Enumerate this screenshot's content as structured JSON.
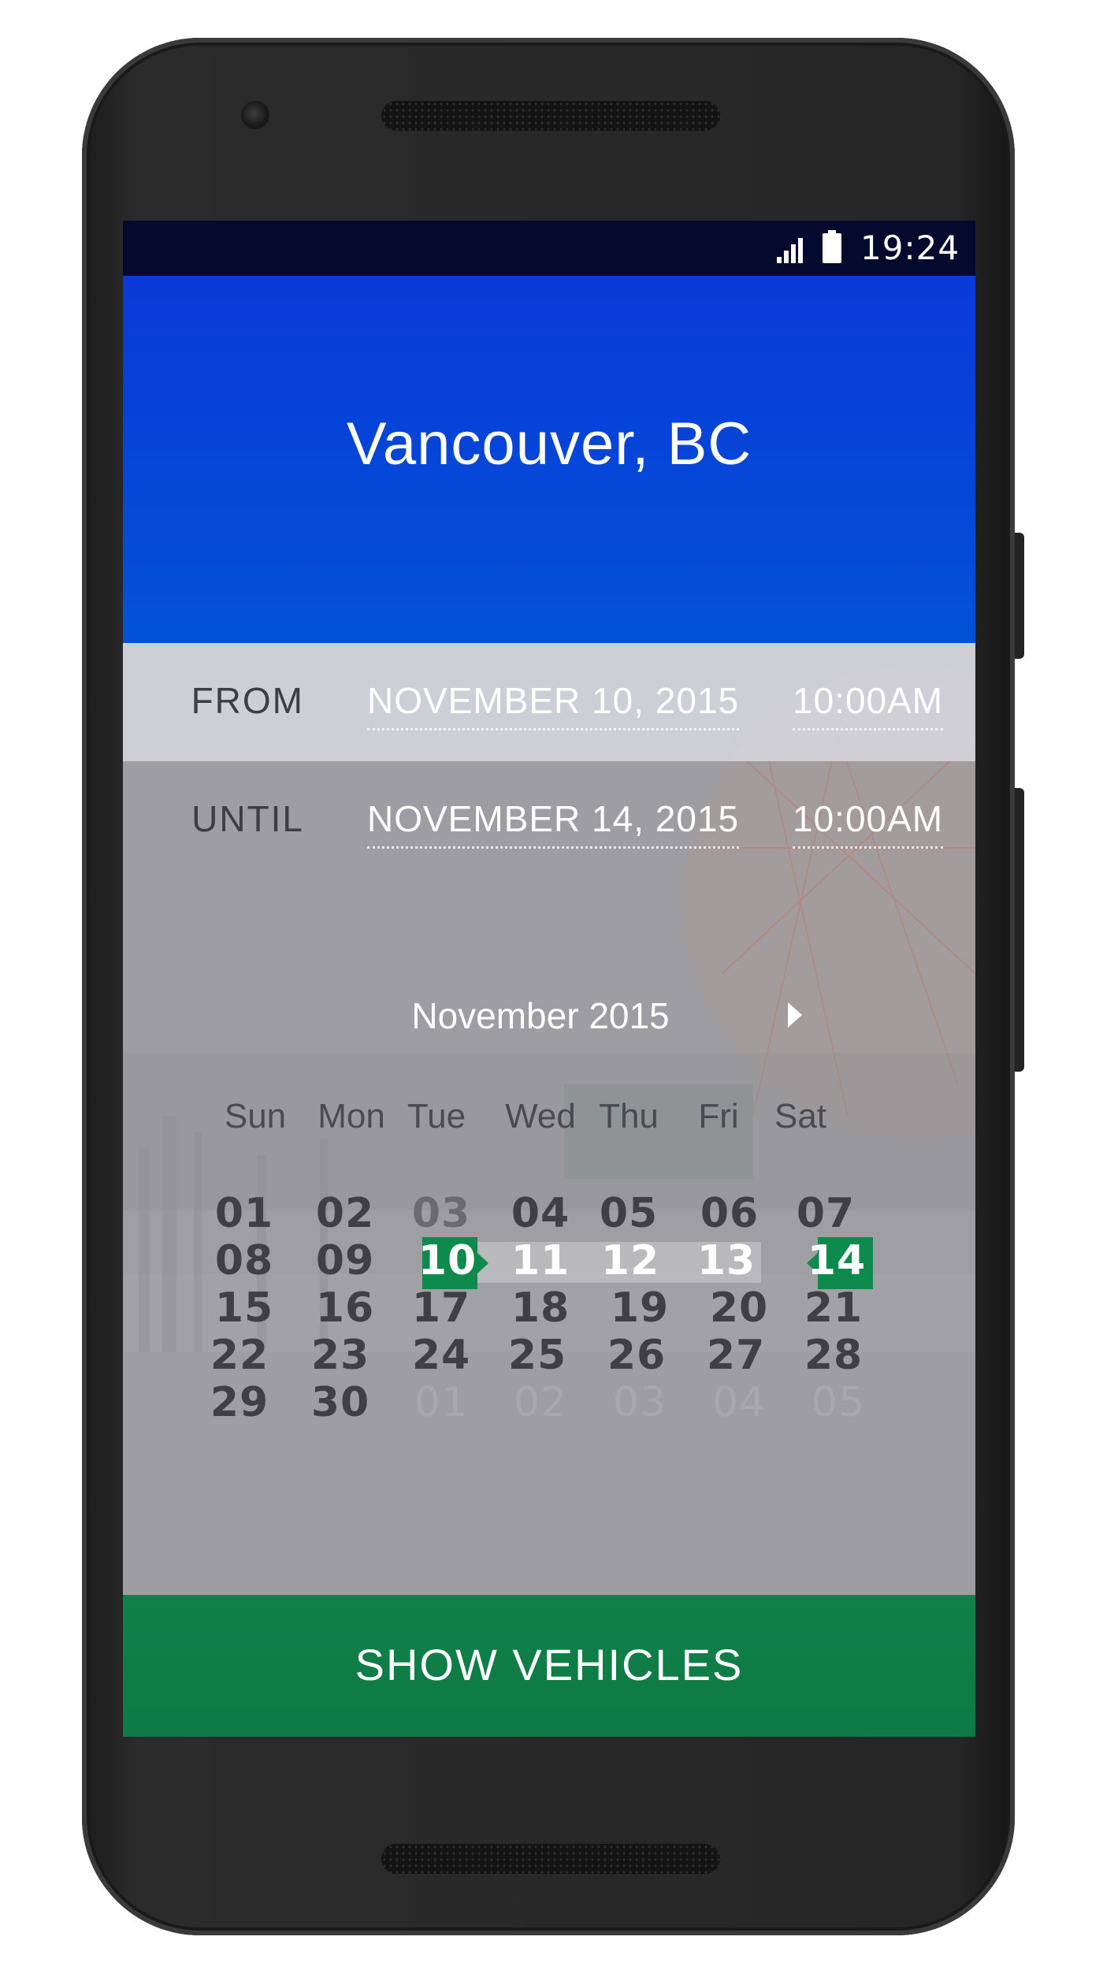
{
  "status_bar": {
    "time": "19:24",
    "icons": [
      "signal-icon",
      "battery-icon"
    ]
  },
  "header": {
    "city": "Vancouver, BC"
  },
  "rental": {
    "from": {
      "label": "FROM",
      "date": "NOVEMBER 10, 2015",
      "time": "10:00AM"
    },
    "until": {
      "label": "UNTIL",
      "date": "NOVEMBER 14, 2015",
      "time": "10:00AM"
    }
  },
  "calendar": {
    "month_title": "November 2015",
    "next_icon": "chevron-right-icon",
    "weekdays": [
      "Sun",
      "Mon",
      "Tue",
      "Wed",
      "Thu",
      "Fri",
      "Sat"
    ],
    "weeks": [
      [
        "01",
        "02",
        "03",
        "04",
        "05",
        "06",
        "07"
      ],
      [
        "08",
        "09",
        "10",
        "11",
        "12",
        "13",
        "14"
      ],
      [
        "15",
        "16",
        "17",
        "18",
        "19",
        "20",
        "21"
      ],
      [
        "22",
        "23",
        "24",
        "25",
        "26",
        "27",
        "28"
      ],
      [
        "29",
        "30",
        "01",
        "02",
        "03",
        "04",
        "05"
      ]
    ],
    "selected_start": "10",
    "selected_end": "14"
  },
  "actions": {
    "show_vehicles": "SHOW VEHICLES"
  },
  "colors": {
    "accent_green": "#0e7a45",
    "header_blue": "#0a3ad8",
    "status_bar": "#040a2e"
  }
}
